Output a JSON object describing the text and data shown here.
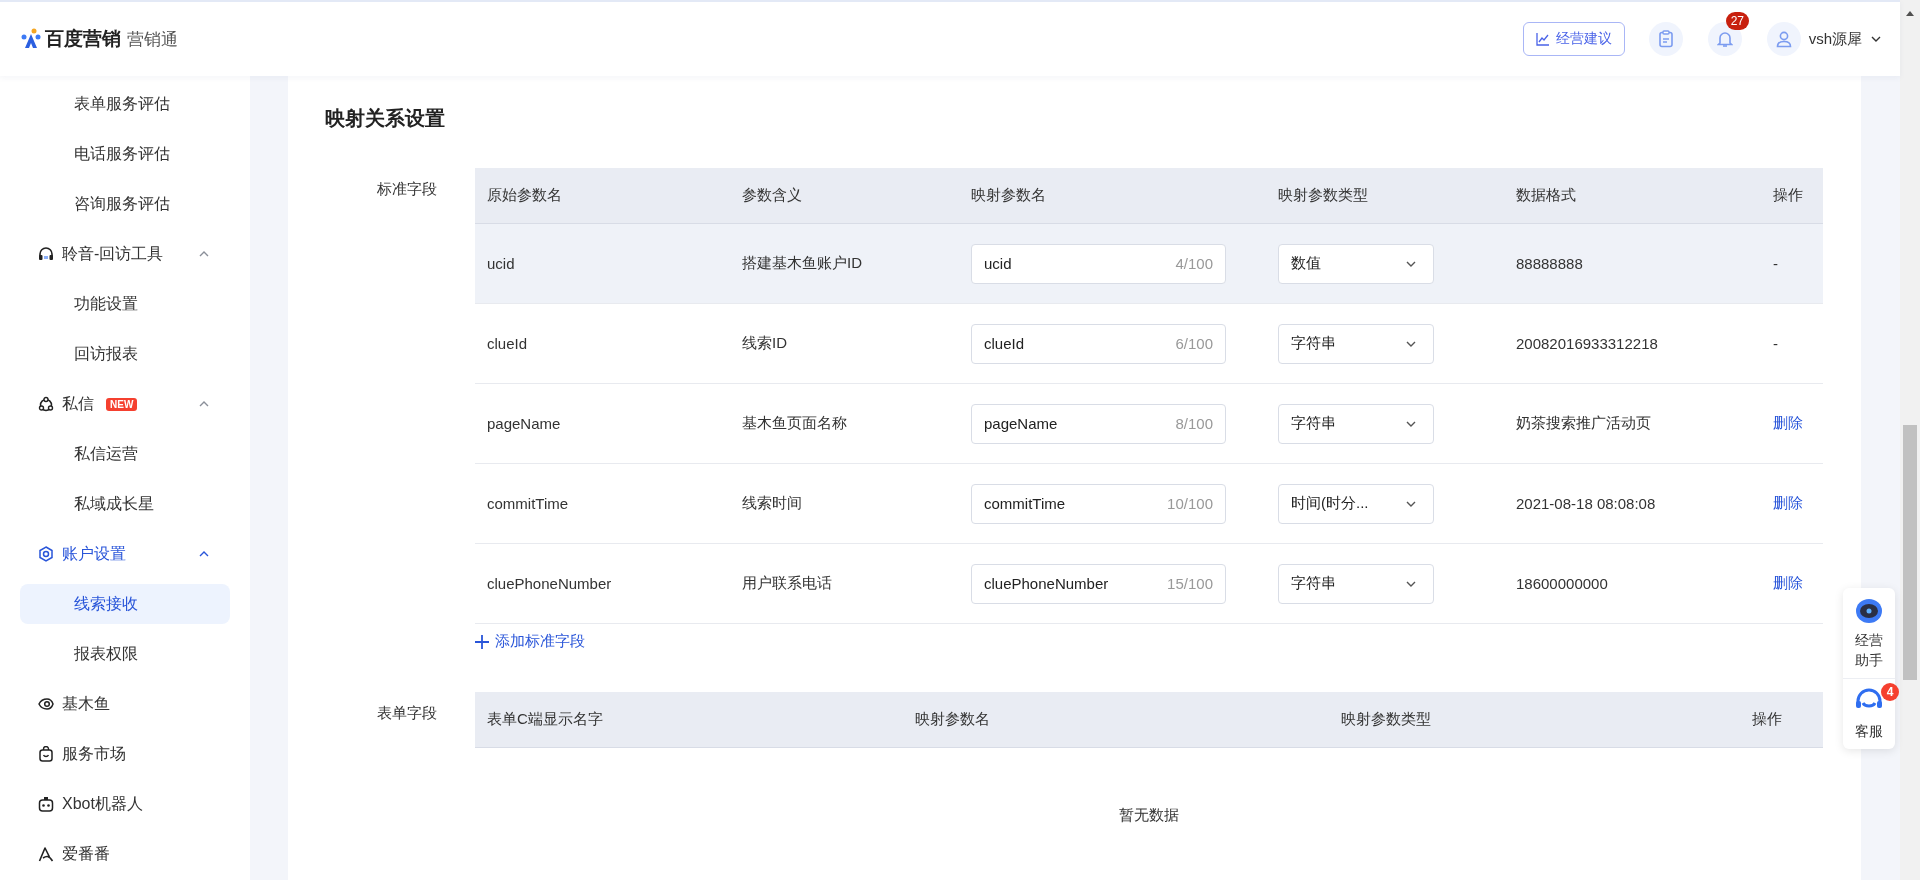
{
  "header": {
    "brand": "百度营销",
    "product": "营销通",
    "advice_button": "经营建议",
    "notification_count": "27",
    "user_name": "vsh源犀"
  },
  "sidebar": {
    "items": [
      {
        "label": "表单服务评估",
        "kind": "sub",
        "selected": false
      },
      {
        "label": "电话服务评估",
        "kind": "sub",
        "selected": false
      },
      {
        "label": "咨询服务评估",
        "kind": "sub",
        "selected": false
      },
      {
        "label": "聆音-回访工具",
        "kind": "group",
        "selected": false,
        "expanded": true,
        "children": [
          {
            "label": "功能设置",
            "selected": false
          },
          {
            "label": "回访报表",
            "selected": false
          }
        ]
      },
      {
        "label": "私信",
        "kind": "group",
        "badge": "NEW",
        "selected": false,
        "expanded": true,
        "children": [
          {
            "label": "私信运营",
            "selected": false
          },
          {
            "label": "私域成长星",
            "selected": false
          }
        ]
      },
      {
        "label": "账户设置",
        "kind": "group",
        "selected": true,
        "expanded": true,
        "children": [
          {
            "label": "线索接收",
            "selected": true
          },
          {
            "label": "报表权限",
            "selected": false
          }
        ]
      },
      {
        "label": "基木鱼",
        "kind": "group",
        "selected": false
      },
      {
        "label": "服务市场",
        "kind": "group",
        "selected": false
      },
      {
        "label": "Xbot机器人",
        "kind": "group",
        "selected": false
      },
      {
        "label": "爱番番",
        "kind": "group",
        "selected": false
      }
    ]
  },
  "section_title": "映射关系设置",
  "standard_fields": {
    "label": "标准字段",
    "columns": [
      "原始参数名",
      "参数含义",
      "映射参数名",
      "映射参数类型",
      "数据格式",
      "操作"
    ],
    "rows": [
      {
        "original_name": "ucid",
        "meaning": "搭建基木鱼账户ID",
        "mapped_name": "ucid",
        "count": "4/100",
        "type": "数值",
        "data_format": "88888888",
        "action": {
          "kind": "none",
          "text": "-"
        },
        "hovered": true
      },
      {
        "original_name": "clueId",
        "meaning": "线索ID",
        "mapped_name": "clueId",
        "count": "6/100",
        "type": "字符串",
        "data_format": "20082016933312218",
        "action": {
          "kind": "none",
          "text": "-"
        },
        "hovered": false
      },
      {
        "original_name": "pageName",
        "meaning": "基木鱼页面名称",
        "mapped_name": "pageName",
        "count": "8/100",
        "type": "字符串",
        "data_format": "奶茶搜索推广活动页",
        "action": {
          "kind": "link",
          "text": "删除"
        },
        "hovered": false
      },
      {
        "original_name": "commitTime",
        "meaning": "线索时间",
        "mapped_name": "commitTime",
        "count": "10/100",
        "type": "时间(时分...",
        "data_format": "2021-08-18 08:08:08",
        "action": {
          "kind": "link",
          "text": "删除"
        },
        "hovered": false
      },
      {
        "original_name": "cluePhoneNumber",
        "meaning": "用户联系电话",
        "mapped_name": "cluePhoneNumber",
        "count": "15/100",
        "type": "字符串",
        "data_format": "18600000000",
        "action": {
          "kind": "link",
          "text": "删除"
        },
        "hovered": false
      }
    ],
    "add_link": "添加标准字段"
  },
  "form_fields": {
    "label": "表单字段",
    "columns": [
      "表单C端显示名字",
      "映射参数名",
      "映射参数类型",
      "操作"
    ],
    "empty_text": "暂无数据"
  },
  "float_panel": [
    {
      "kind": "assistant",
      "label": "经营助手"
    },
    {
      "kind": "service",
      "label": "客服",
      "badge": "4"
    }
  ]
}
